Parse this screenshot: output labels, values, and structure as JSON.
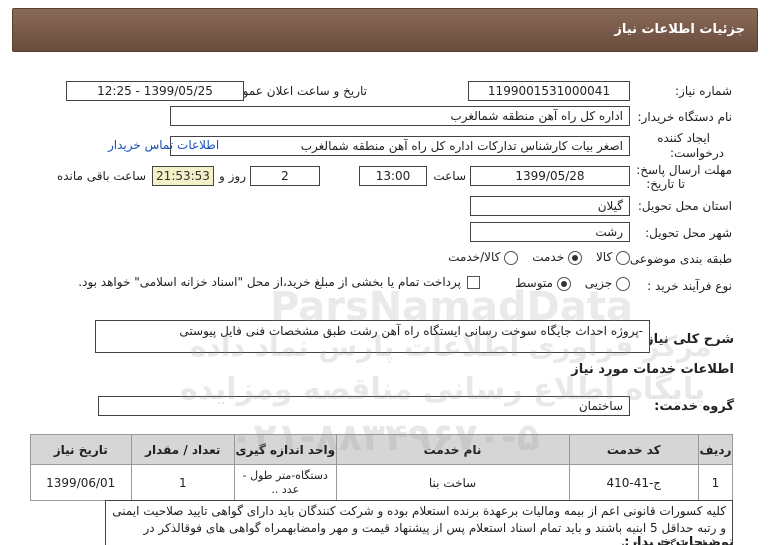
{
  "header": {
    "title": "جزئیات اطلاعات نیاز"
  },
  "form": {
    "need_number_label": "شماره نیاز:",
    "need_number": "1199001531000041",
    "announce_label": "تاریخ و ساعت اعلان عمومی:",
    "announce_value": "1399/05/25 - 12:25",
    "buyer_label": "نام دستگاه خریدار:",
    "buyer_value": "اداره کل راه آهن منطقه شمالغرب",
    "requester_label_1": "ایجاد کننده",
    "requester_label_2": "درخواست:",
    "requester_value": "اصغر بیات کارشناس تدارکات اداره کل راه آهن منطقه شمالغرب",
    "contact_link": "اطلاعات تماس خریدار",
    "deadline_label_1": "مهلت ارسال پاسخ:",
    "deadline_label_2": "تا تاریخ:",
    "deadline_date": "1399/05/28",
    "time_label": "ساعت",
    "deadline_time": "13:00",
    "days_value": "2",
    "days_label": "روز و",
    "remaining_time": "21:53:53",
    "remaining_label": "ساعت باقی مانده",
    "province_label": "استان محل تحویل:",
    "province_value": "گیلان",
    "city_label": "شهر محل تحویل:",
    "city_value": "رشت",
    "category_label": "طبقه بندی موضوعی:",
    "category_options": [
      "کالا",
      "خدمت",
      "کالا/خدمت"
    ],
    "category_selected": "خدمت",
    "process_label": "نوع فرآیند خرید :",
    "process_options": [
      "جزیی",
      "متوسط"
    ],
    "process_selected": "متوسط",
    "payment_note": "پرداخت تمام یا بخشی از مبلغ خرید،از محل \"اسناد خزانه اسلامی\" خواهد بود."
  },
  "summary": {
    "label": "شرح کلی نیاز:",
    "value": "-پروژه احداث جایگاه سوخت رسانی ایستگاه راه آهن رشت طبق مشخصات  فنی فایل پیوستی"
  },
  "services": {
    "section_title": "اطلاعات خدمات مورد نیاز",
    "group_label": "گروه خدمت:",
    "group_value": "ساختمان",
    "columns": [
      "ردیف",
      "کد خدمت",
      "نام خدمت",
      "واحد اندازه گیری",
      "تعداد / مقدار",
      "تاریخ نیاز"
    ],
    "rows": [
      {
        "index": "1",
        "code": "ج-41-410",
        "name": "ساخت بنا",
        "unit": "دستگاه-متر طول - عدد ..",
        "qty": "1",
        "date": "1399/06/01"
      }
    ]
  },
  "buyer_notes": {
    "label": "توضیحات خریدار:",
    "text": "کلیه کسورات قانونی اعم از بیمه ومالیات برعهدة برنده استعلام بوده و شرکت کنندگان باید دارای گواهی تایید صلاحیت ایمنی و رتبه حداقل 5 ابنیه باشند و باید تمام اسناد استعلام پس از پیشنهاد قیمت و مهر وامضابهمراه گواهی های فوقالذکر در سامانه بارگذاری شود"
  },
  "watermark": {
    "latin": "ParsNamadData",
    "line1": "مرکز فراوری اطلاعات پارس نماد داده",
    "line2": "پایگاه اطلاع رسانی مناقصه ومزایده",
    "phone": "۰۲۱-۸۸۳۴۹۶۷۰-۵"
  }
}
